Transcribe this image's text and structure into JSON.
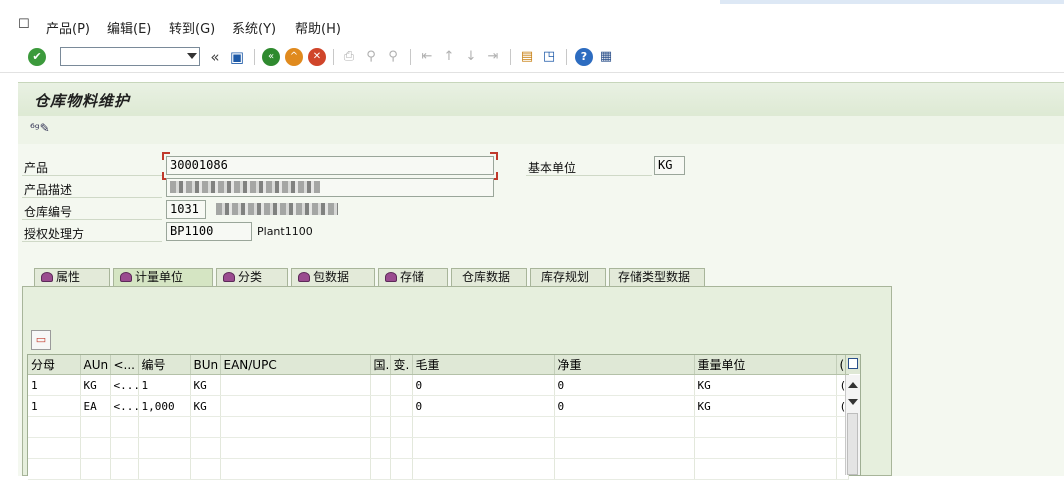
{
  "menu": {
    "items": [
      {
        "label": "产品(P)"
      },
      {
        "label": "编辑(E)"
      },
      {
        "label": "转到(G)"
      },
      {
        "label": "系统(Y)"
      },
      {
        "label": "帮助(H)"
      }
    ]
  },
  "toolbar": {
    "command_value": "",
    "icons": [
      "enter-icon",
      "back-double-icon",
      "save-icon",
      "back-icon",
      "exit-icon",
      "cancel-icon",
      "print-icon",
      "find-icon",
      "find-next-icon",
      "first-page-icon",
      "prev-page-icon",
      "next-page-icon",
      "last-page-icon",
      "create-session-icon",
      "shortcut-icon",
      "help-icon",
      "customize-icon"
    ]
  },
  "screen": {
    "title": "仓库物料维护"
  },
  "header": {
    "product_label": "产品",
    "product_value": "30001086",
    "base_unit_label": "基本单位",
    "base_unit_value": "KG",
    "product_desc_label": "产品描述",
    "warehouse_label": "仓库编号",
    "warehouse_value": "1031",
    "party_label": "授权处理方",
    "party_value": "BP1100",
    "party_desc": "Plant1100"
  },
  "tabs": [
    {
      "label": "属性",
      "active": false
    },
    {
      "label": "计量单位",
      "active": true
    },
    {
      "label": "分类",
      "active": false
    },
    {
      "label": "包数据",
      "active": false
    },
    {
      "label": "存储",
      "active": false
    },
    {
      "label": "仓库数据",
      "active": false
    },
    {
      "label": "库存规划",
      "active": false
    },
    {
      "label": "存储类型数据",
      "active": false
    }
  ],
  "uom_table": {
    "columns": [
      "分母",
      "AUn",
      "<...",
      "编号",
      "BUn",
      "EAN/UPC",
      "国.",
      "变.",
      "毛重",
      "净重",
      "重量单位",
      "("
    ],
    "rows": [
      [
        "1",
        "KG",
        "<...",
        "1",
        "KG",
        "",
        "",
        "",
        "0",
        "0",
        "KG",
        "("
      ],
      [
        "1",
        "EA",
        "<...",
        "1,000",
        "KG",
        "",
        "",
        "",
        "0",
        "0",
        "KG",
        "("
      ]
    ]
  },
  "colors": {
    "title_bg": "#e9f1e3",
    "panel_bg": "#e6efdd",
    "accent_red": "#c0392b"
  }
}
